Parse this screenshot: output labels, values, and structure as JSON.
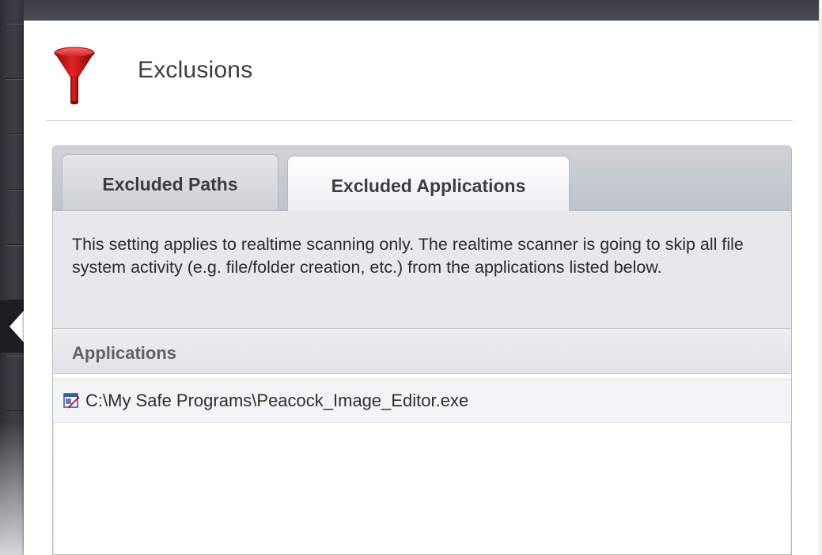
{
  "header": {
    "title": "Exclusions",
    "icon": "funnel-icon",
    "icon_color": "#d01818"
  },
  "tabs": [
    {
      "label": "Excluded Paths",
      "active": false
    },
    {
      "label": "Excluded Applications",
      "active": true
    }
  ],
  "description": "This setting applies to realtime scanning only. The realtime scanner is going to skip all file system activity (e.g. file/folder creation, etc.) from the applications listed below.",
  "applications": {
    "header": "Applications",
    "items": [
      {
        "path": "C:\\My Safe Programs\\Peacock_Image_Editor.exe",
        "icon": "application-icon"
      }
    ]
  }
}
